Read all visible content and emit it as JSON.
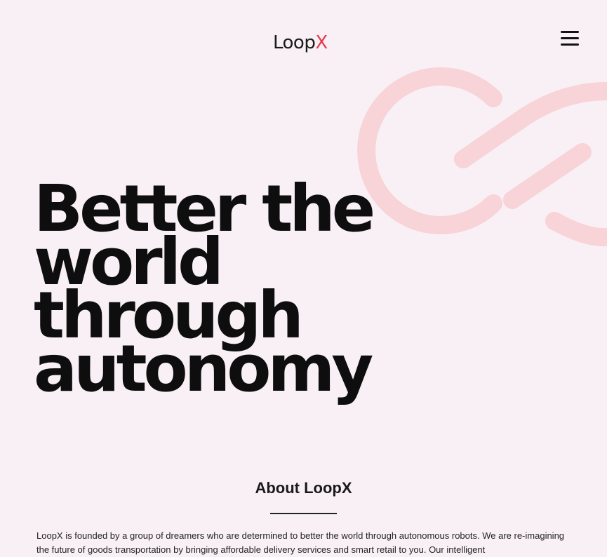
{
  "header": {
    "logo": {
      "text_main": "Loop",
      "text_accent": "X"
    },
    "menu": {
      "icon": "hamburger-menu-icon"
    }
  },
  "hero": {
    "title_lines": [
      "Better the",
      "world",
      "through",
      "autonomy"
    ],
    "graphic": {
      "icon": "loopx-link-mark",
      "color": "#f8d3d8"
    }
  },
  "about": {
    "heading": "About LoopX",
    "body": "LoopX is founded by a group of dreamers who are determined to better the world through autonomous robots. We are re-imagining the future of goods transportation by bringing affordable delivery services and smart retail to you. Our intelligent"
  },
  "colors": {
    "background": "#f8f0f5",
    "accent": "#e8394c",
    "text": "#111111"
  }
}
